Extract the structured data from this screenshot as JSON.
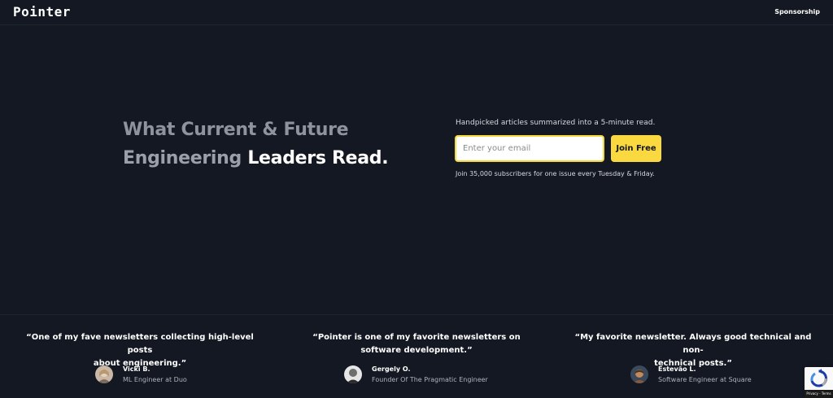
{
  "header": {
    "logo": "Pointer",
    "sponsorship_link": "Sponsorship"
  },
  "hero": {
    "headline_line1": "What Current & Future",
    "headline_line2_a": "Engineering ",
    "headline_line2_b": "Leaders Read.",
    "tagline": "Handpicked articles summarized into a 5-minute read.",
    "email_placeholder": "Enter your email",
    "email_value": "",
    "join_button_label": "Join Free",
    "subnote": "Join 35,000 subscribers for one issue every Tuesday & Friday."
  },
  "testimonials": [
    {
      "quote_line1": "“One of my fave newsletters collecting high-level posts",
      "quote_line2": "about engineering.”",
      "name": "Vicki B.",
      "role": "ML Engineer at Duo"
    },
    {
      "quote_line1": "“Pointer is one of my favorite newsletters on",
      "quote_line2": "software development.”",
      "name": "Gergely O.",
      "role": "Founder Of The Pragmatic Engineer"
    },
    {
      "quote_line1": "“My favorite newsletter. Always good technical and non-",
      "quote_line2": "technical posts.”",
      "name": "Estevão L.",
      "role": "Software Engineer at Square"
    }
  ],
  "recaptcha": {
    "footer_text": "Privacy - Terms"
  },
  "colors": {
    "background": "#141822",
    "accent": "#f9d93f",
    "muted_text": "#8f939d"
  }
}
